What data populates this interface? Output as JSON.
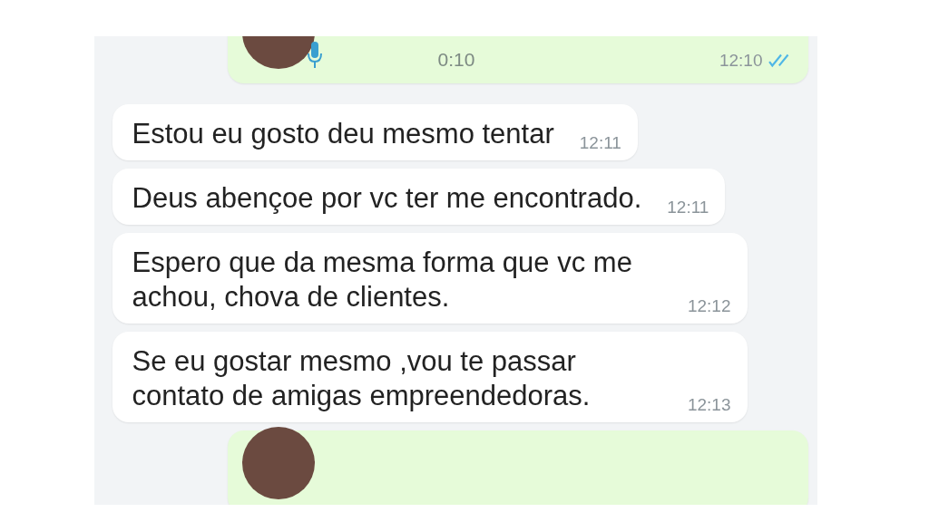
{
  "messages": [
    {
      "kind": "voice",
      "outgoing": true,
      "duration": "0:10",
      "time": "12:10",
      "read": true
    },
    {
      "kind": "text",
      "outgoing": false,
      "text": "Estou eu gosto deu mesmo tentar",
      "time": "12:11"
    },
    {
      "kind": "text",
      "outgoing": false,
      "text": "Deus abençoe  por vc ter me encontrado.",
      "time": "12:11"
    },
    {
      "kind": "text",
      "outgoing": false,
      "text": "Espero que da mesma forma que vc me achou, chova de clientes.",
      "time": "12:12"
    },
    {
      "kind": "text",
      "outgoing": false,
      "text": "Se eu gostar mesmo ,vou te passar contato de amigas empreendedoras.",
      "time": "12:13"
    },
    {
      "kind": "voice",
      "outgoing": true
    }
  ]
}
